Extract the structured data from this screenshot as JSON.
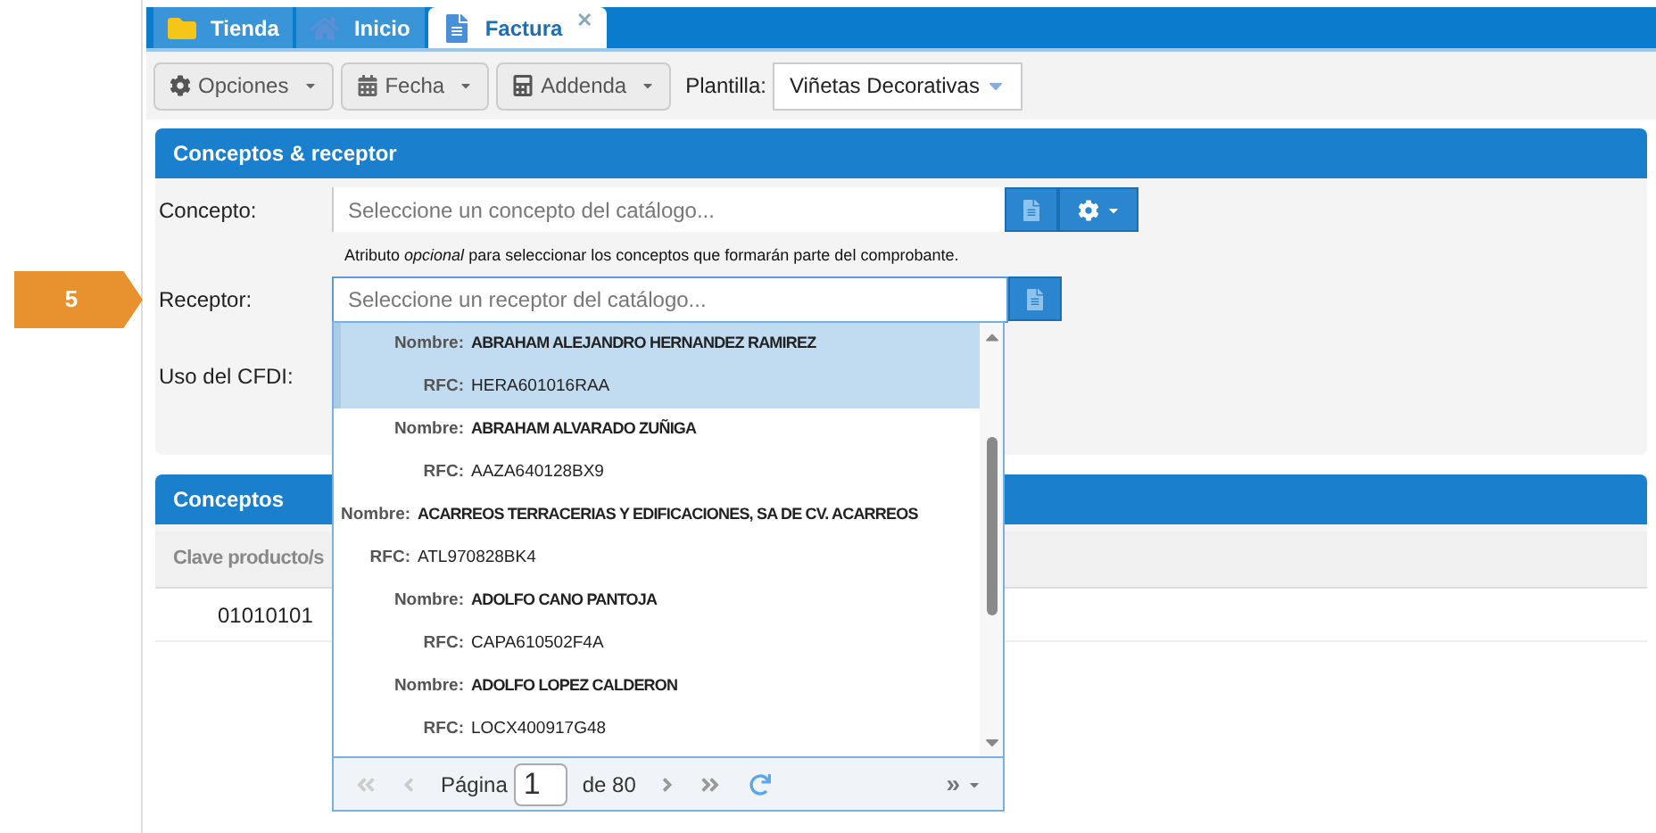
{
  "step_badge": "5",
  "tabs": [
    {
      "label": "Tienda",
      "selected": false
    },
    {
      "label": "Inicio",
      "selected": false
    },
    {
      "label": "Factura",
      "selected": true,
      "close": "✕"
    }
  ],
  "toolbar": {
    "buttons": [
      {
        "label": "Opciones"
      },
      {
        "label": "Fecha"
      },
      {
        "label": "Addenda"
      }
    ],
    "template_label": "Plantilla:",
    "template_value": "Viñetas Decorativas"
  },
  "receptor_panel": {
    "title": "Conceptos & receptor",
    "concepto_label": "Concepto:",
    "concepto_placeholder": "Seleccione un concepto del catálogo...",
    "hint": "Atributo *opcional* para seleccionar los conceptos que formarán parte del comprobante.",
    "receptor_label": "Receptor:",
    "receptor_placeholder": "Seleccione un receptor del catálogo...",
    "uso_label": "Uso del CFDI:"
  },
  "conceptos_panel": {
    "title": "Conceptos",
    "column_1": "Clave producto/s",
    "rows": [
      "01010101"
    ]
  },
  "dropdown": {
    "items": [
      {
        "name_label": "Nombre:",
        "name": "ABRAHAM ALEJANDRO HERNANDEZ RAMIREZ",
        "rfc_label": "RFC:",
        "rfc": "HERA601016RAA",
        "selected": true
      },
      {
        "name_label": "Nombre:",
        "name": "ABRAHAM ALVARADO ZUÑIGA",
        "rfc_label": "RFC:",
        "rfc": "AAZA640128BX9",
        "selected": false
      },
      {
        "name_label": "Nombre:",
        "name": "ACARREOS TERRACERIAS Y EDIFICACIONES, SA DE CV. ACARREOS",
        "rfc_label": "RFC:",
        "rfc": "ATL970828BK4",
        "selected": false
      },
      {
        "name_label": "Nombre:",
        "name": "ADOLFO CANO PANTOJA",
        "rfc_label": "RFC:",
        "rfc": "CAPA610502F4A",
        "selected": false
      },
      {
        "name_label": "Nombre:",
        "name": "ADOLFO LOPEZ CALDERON",
        "rfc_label": "RFC:",
        "rfc": "LOCX400917G48",
        "selected": false
      }
    ],
    "pager": {
      "page_label": "Página",
      "page": "1",
      "total": "de 80",
      "overflow": "»"
    }
  }
}
